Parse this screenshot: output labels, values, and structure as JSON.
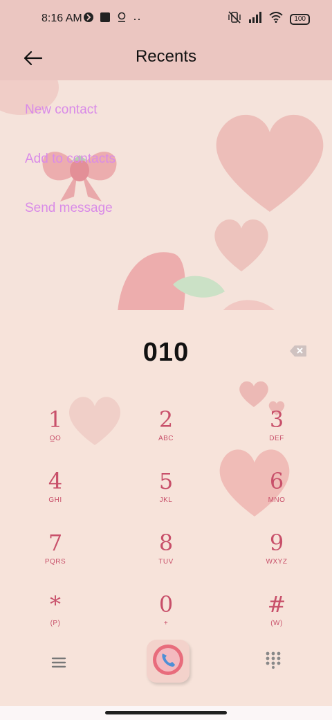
{
  "status_bar": {
    "time": "8:16 AM",
    "left_icons": [
      "vpn-shield-icon",
      "app-square-icon",
      "assistant-icon",
      "more-dots-icon"
    ],
    "right_icons": [
      "mute-vibrate-icon",
      "cell-signal-icon",
      "wifi-icon",
      "battery-icon"
    ],
    "battery": "100",
    "more_dots": "··"
  },
  "app_bar": {
    "title": "Recents",
    "back_icon": "arrow-left-icon"
  },
  "options": [
    {
      "label": "New contact"
    },
    {
      "label": "Add to contacts"
    },
    {
      "label": "Send message"
    }
  ],
  "dialer": {
    "number": "010",
    "keys": [
      {
        "digit": "1",
        "letters": "O̲O"
      },
      {
        "digit": "2",
        "letters": "ABC"
      },
      {
        "digit": "3",
        "letters": "DEF"
      },
      {
        "digit": "4",
        "letters": "GHI"
      },
      {
        "digit": "5",
        "letters": "JKL"
      },
      {
        "digit": "6",
        "letters": "MNO"
      },
      {
        "digit": "7",
        "letters": "PQRS"
      },
      {
        "digit": "8",
        "letters": "TUV"
      },
      {
        "digit": "9",
        "letters": "WXYZ"
      },
      {
        "digit": "*",
        "letters": "(P)"
      },
      {
        "digit": "0",
        "letters": "+"
      },
      {
        "digit": "#",
        "letters": "(W)"
      }
    ]
  },
  "colors": {
    "accent_text": "#d98be8",
    "key_color": "#c8506a",
    "header_bg": "#ebc6c1"
  }
}
